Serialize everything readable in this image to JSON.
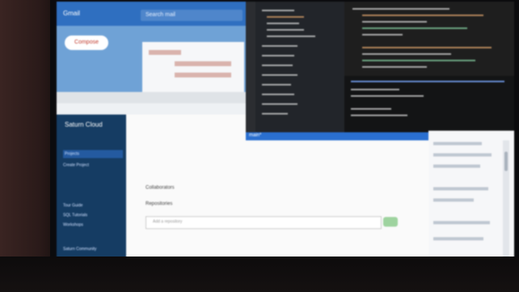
{
  "scene": {
    "label": "Photo of laptop screen showing multiple windows"
  },
  "gmail": {
    "title": "Gmail",
    "search_placeholder": "Search mail",
    "compose_label": "Compose"
  },
  "saturn": {
    "brand": "Saturn Cloud",
    "nav_items": [
      "Projects",
      "Create Project",
      "Tour Guide",
      "SQL Tutorials",
      "Workshops",
      "Saturn Community"
    ]
  },
  "vscode": {
    "status_text": "main*"
  },
  "content": {
    "collaborators_label": "Collaborators",
    "repositories_label": "Repositories",
    "add_repo_placeholder": "Add a repository"
  }
}
